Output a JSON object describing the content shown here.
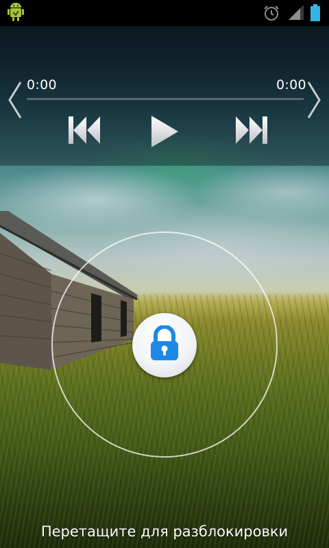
{
  "status_bar": {
    "icons": [
      "android-debug-icon",
      "alarm-icon",
      "signal-icon",
      "battery-icon"
    ]
  },
  "music": {
    "elapsed": "0:00",
    "total": "0:00",
    "progress": 0,
    "controls": [
      "previous-track-icon",
      "play-icon",
      "next-track-icon"
    ],
    "accent_color": "#33b5e5"
  },
  "lock": {
    "hint": "Перетащите для разблокировки",
    "icon": "padlock-icon",
    "icon_color": "#1e88e5"
  }
}
